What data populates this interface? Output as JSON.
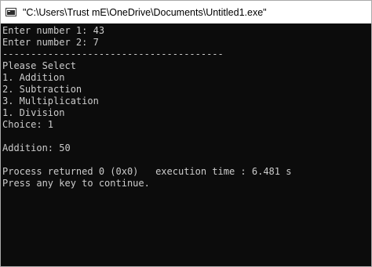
{
  "window": {
    "title": "\"C:\\Users\\Trust mE\\OneDrive\\Documents\\Untitled1.exe\"",
    "icon": "console-window-icon"
  },
  "console": {
    "lines": [
      "Enter number 1: 43",
      "Enter number 2: 7",
      "---------------------------------------",
      "Please Select",
      "1. Addition",
      "2. Subtraction",
      "3. Multiplication",
      "1. Division",
      "Choice: 1",
      "",
      "Addition: 50",
      "",
      "Process returned 0 (0x0)   execution time : 6.481 s",
      "Press any key to continue."
    ]
  },
  "colors": {
    "console_background": "#0c0c0c",
    "console_text": "#cccccc",
    "titlebar_background": "#ffffff"
  }
}
